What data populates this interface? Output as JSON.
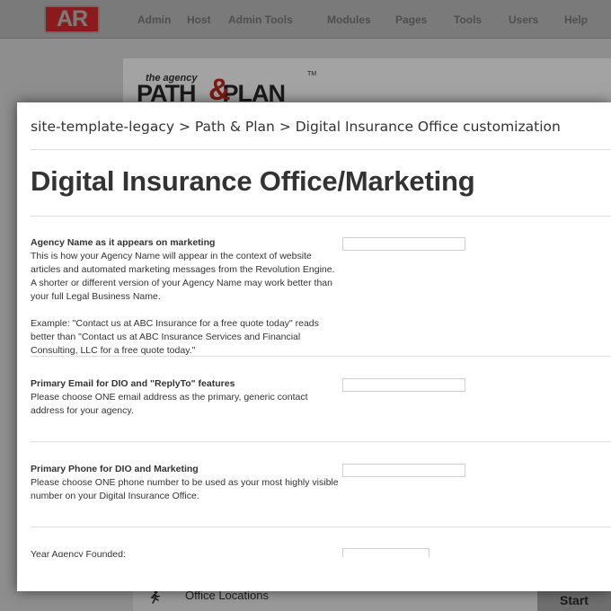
{
  "app": {
    "logo_text": "AR",
    "nav": [
      "Admin",
      "Host",
      "Admin Tools",
      "Modules",
      "Pages",
      "Tools",
      "Users",
      "Help"
    ]
  },
  "brand": {
    "small": "the agency",
    "path": "PATH",
    "amp": "&",
    "plan": "PLAN",
    "tm": "TM"
  },
  "background": {
    "runner_icon": "runner-icon",
    "office_locations": "Office Locations",
    "start_label": "Start"
  },
  "modal": {
    "breadcrumb": [
      "site-template-legacy",
      "Path & Plan",
      "Digital Insurance Office customization"
    ],
    "breadcrumb_sep": ">",
    "title": "Digital Insurance Office/Marketing",
    "fields": [
      {
        "label": "Agency Name as it appears on marketing",
        "desc": "This is how your Agency Name will appear in the context of website articles and automated marketing messages from the Revolution Engine. A shorter or different version of your Agency Name may work better than your full Legal Business Name.",
        "desc2": "Example: \"Contact us at ABC Insurance for a free quote today\" reads better than \"Contact us at ABC Insurance Services and Financial Consulting, LLC for a free quote today.\"",
        "value": ""
      },
      {
        "label": "Primary Email for DIO and \"ReplyTo\" features",
        "desc": "Please choose ONE email address as the primary, generic contact address for your agency.",
        "value": ""
      },
      {
        "label": "Primary Phone for DIO and Marketing",
        "desc": "Please choose ONE phone number to be used as your most highly visible number on your Digital Insurance Office.",
        "value": ""
      },
      {
        "label": "Year Agency Founded:",
        "value": ""
      }
    ]
  }
}
